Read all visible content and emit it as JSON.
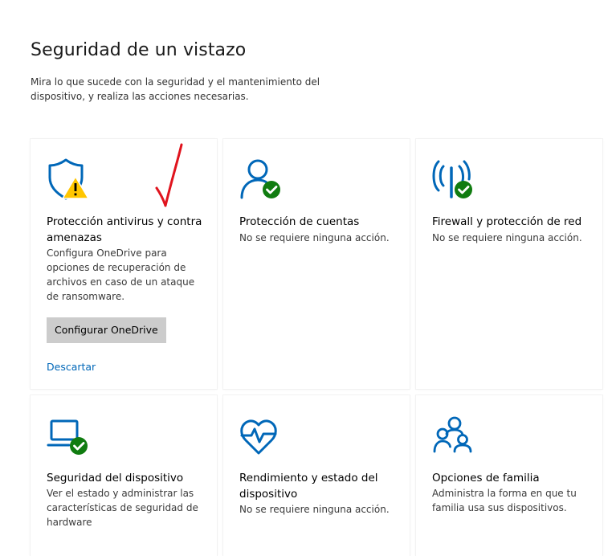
{
  "page": {
    "title": "Seguridad de un vistazo",
    "subtitle": "Mira lo que sucede con la seguridad y el mantenimiento del dispositivo, y realiza las acciones necesarias."
  },
  "colors": {
    "accent_blue": "#0067b8",
    "ok_green": "#107c10",
    "warning_yellow": "#ffc600",
    "button_gray": "#cccccc",
    "annotation_red": "#e0141e"
  },
  "tiles": {
    "antivirus": {
      "icon": "shield-warning-icon",
      "title": "Protección antivirus y contra amenazas",
      "description": "Configura OneDrive para opciones de recuperación de archivos en caso de un ataque de ransomware.",
      "button_label": "Configurar OneDrive",
      "link_label": "Descartar"
    },
    "accounts": {
      "icon": "person-check-icon",
      "title": "Protección de cuentas",
      "description": "No se requiere ninguna acción."
    },
    "firewall": {
      "icon": "antenna-check-icon",
      "title": "Firewall y protección de red",
      "description": "No se requiere ninguna acción."
    },
    "device_security": {
      "icon": "laptop-check-icon",
      "title": "Seguridad del dispositivo",
      "description": "Ver el estado y administrar las características de seguridad de hardware"
    },
    "performance": {
      "icon": "heart-pulse-icon",
      "title": "Rendimiento y estado del dispositivo",
      "description": "No se requiere ninguna acción."
    },
    "family": {
      "icon": "family-icon",
      "title": "Opciones de familia",
      "description": "Administra la forma en que tu familia usa sus dispositivos."
    }
  }
}
